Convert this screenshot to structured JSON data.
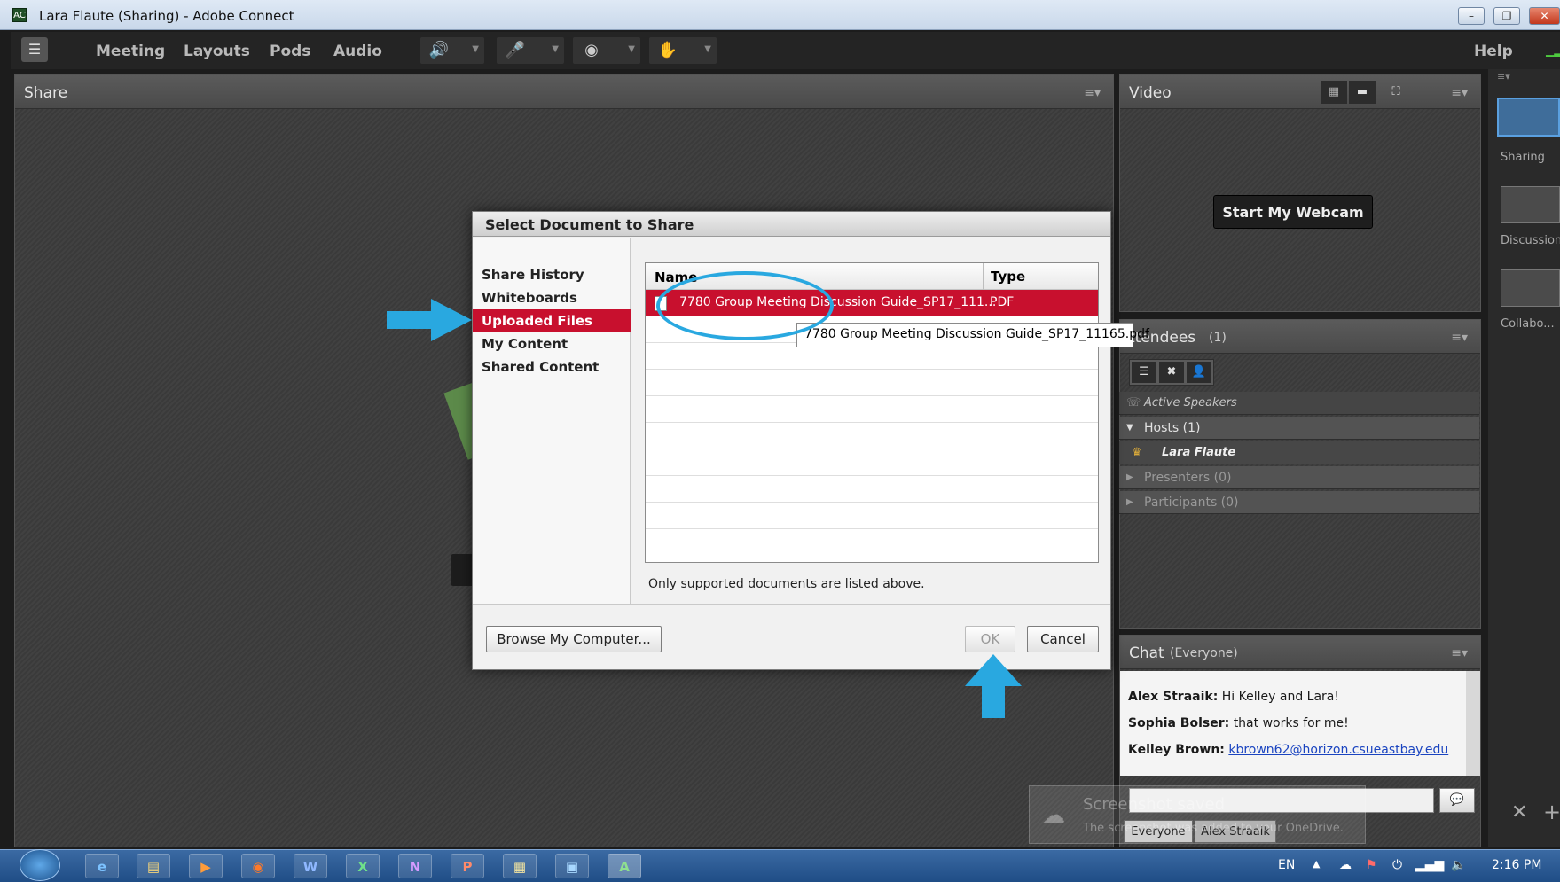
{
  "window": {
    "title": "Lara Flaute (Sharing) - Adobe Connect",
    "min": "–",
    "max": "❐",
    "close": "✕"
  },
  "menu": {
    "items": [
      "Meeting",
      "Layouts",
      "Pods",
      "Audio"
    ],
    "help": "Help"
  },
  "share_pod": {
    "title": "Share"
  },
  "dialog": {
    "title": "Select Document to Share",
    "nav": [
      "Share History",
      "Whiteboards",
      "Uploaded Files",
      "My Content",
      "Shared Content"
    ],
    "selected_nav": "Uploaded Files",
    "table": {
      "col_name": "Name",
      "col_type": "Type",
      "rows": [
        {
          "name": "7780 Group Meeting Discussion Guide_SP17_111...",
          "type": "PDF"
        }
      ]
    },
    "tooltip": "7780 Group Meeting Discussion Guide_SP17_11165.pdf",
    "note": "Only supported documents are listed above.",
    "browse_label": "Browse My Computer...",
    "ok_label": "OK",
    "cancel_label": "Cancel"
  },
  "video_pod": {
    "title": "Video",
    "webcam_button": "Start My Webcam"
  },
  "attendees_pod": {
    "title": "ttendees",
    "count": "(1)",
    "active_speakers": "Active Speakers",
    "hosts": "Hosts (1)",
    "host_name": "Lara Flaute",
    "presenters": "Presenters (0)",
    "participants": "Participants (0)"
  },
  "chat_pod": {
    "title": "Chat",
    "scope": "(Everyone)",
    "messages": [
      {
        "sender": "Alex Straaik:",
        "text": "Hi Kelley and Lara!"
      },
      {
        "sender": "Sophia Bolser:",
        "text": "that works for me!"
      },
      {
        "sender": "Kelley Brown:",
        "link": "kbrown62@horizon.csueastbay.edu"
      }
    ],
    "tabs": [
      "Everyone",
      "Alex Straaik"
    ]
  },
  "layouts_panel": {
    "items": [
      "Sharing",
      "Discussion",
      "Collabo..."
    ]
  },
  "toast": {
    "title": "Screenshot saved",
    "body": "The screenshot was added to your OneDrive."
  },
  "taskbar": {
    "apps": [
      "e",
      "▤",
      "▶",
      "◉",
      "W",
      "X",
      "N",
      "P",
      "▦",
      "▣",
      "A"
    ],
    "lang": "EN",
    "time": "2:16 PM"
  },
  "colors": {
    "accent_red": "#c8102e",
    "annotation_blue": "#29a8e0",
    "pod_bg": "#3d3d3d"
  }
}
